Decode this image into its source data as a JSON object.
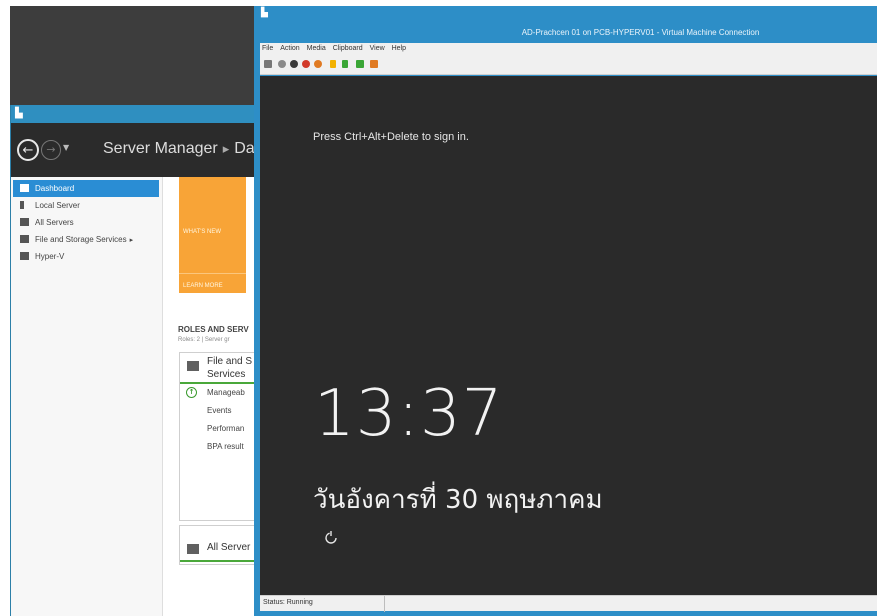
{
  "server_manager": {
    "breadcrumb_app": "Server Manager",
    "breadcrumb_separator": "▸",
    "breadcrumb_page": "Das",
    "sidebar": {
      "items": [
        {
          "label": "Dashboard",
          "active": true
        },
        {
          "label": "Local Server",
          "active": false
        },
        {
          "label": "All Servers",
          "active": false
        },
        {
          "label": "File and Storage Services",
          "active": false,
          "arrow": "▸"
        },
        {
          "label": "Hyper-V",
          "active": false
        }
      ]
    },
    "quickstart": {
      "whats_new": "WHAT'S NEW",
      "learn_more": "LEARN MORE"
    },
    "roles": {
      "title": "ROLES AND SERV",
      "subtitle": "Roles: 2  |  Server gr",
      "file_card": {
        "title_line1": "File and S",
        "title_line2": "Services",
        "rows": [
          "Manageab",
          "Events",
          "Performan",
          "BPA result"
        ]
      },
      "all_card": {
        "title": "All Server"
      }
    }
  },
  "vm_connection": {
    "title": "AD-Prachcen 01 on PCB-HYPERV01 - Virtual Machine Connection",
    "menu": [
      "File",
      "Action",
      "Media",
      "Clipboard",
      "View",
      "Help"
    ],
    "toolbar_colors": [
      "#777777",
      "#8a8a8a",
      "#3a3a3a",
      "#d23a2a",
      "#e07a22",
      "#f2b100",
      "#3aa636",
      "#3aa636",
      "#e07a22"
    ],
    "lock_screen": {
      "prompt": "Press Ctrl+Alt+Delete to sign in.",
      "time": "13:37",
      "date": "วันอังคารที่ 30 พฤษภาคม"
    },
    "status": "Status: Running"
  }
}
